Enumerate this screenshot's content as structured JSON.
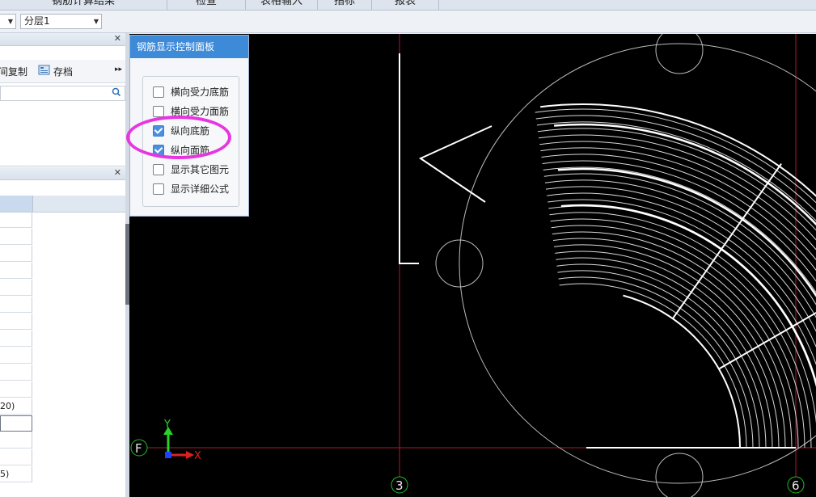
{
  "menu": {
    "tabs": [
      "钢筋计算结果",
      "检查",
      "表格输入",
      "指标",
      "报表"
    ]
  },
  "toolbar": {
    "combo_left_value": "",
    "combo_layer_value": "分层1"
  },
  "left_panel": {
    "tool_copy": "间复制",
    "tool_save": "存档",
    "row_label_a": "20)",
    "row_label_b": "5)"
  },
  "control_panel": {
    "title": "钢筋显示控制面板",
    "options": [
      {
        "label": "横向受力底筋",
        "checked": false
      },
      {
        "label": "横向受力面筋",
        "checked": false
      },
      {
        "label": "纵向底筋",
        "checked": true
      },
      {
        "label": "纵向面筋",
        "checked": true
      },
      {
        "label": "显示其它图元",
        "checked": false
      },
      {
        "label": "显示详细公式",
        "checked": false
      }
    ]
  },
  "canvas": {
    "axis_x": "X",
    "axis_y": "Y",
    "grid_F": "F",
    "grid_3": "3",
    "grid_6": "6"
  },
  "colors": {
    "canvas_bg": "#000000",
    "rebar": "#ffffff",
    "grid_line": "#b3162c",
    "grid_bubble": "#1ec21e",
    "annotation": "#e735e0",
    "panel_title": "#3d8ad8"
  }
}
